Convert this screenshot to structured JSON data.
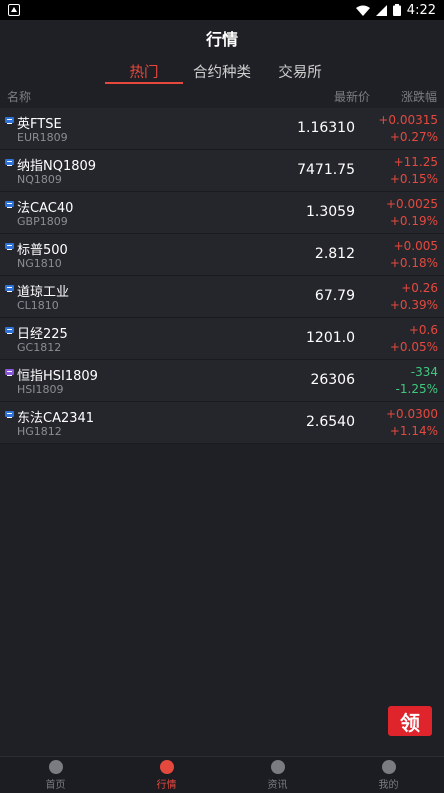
{
  "header": {
    "title": "行情"
  },
  "tabs": [
    {
      "label": "热门",
      "active": true
    },
    {
      "label": "合约种类",
      "active": false
    },
    {
      "label": "交易所",
      "active": false
    }
  ],
  "columns": {
    "name": "名称",
    "price": "最新价",
    "change": "涨跌幅"
  },
  "rows": [
    {
      "name": "英FTSE",
      "code": "EUR1809",
      "price": "1.16310",
      "change": "+0.00315",
      "pct": "+0.27%",
      "dir": "up",
      "badge": "blue"
    },
    {
      "name": "纳指NQ1809",
      "code": "NQ1809",
      "price": "7471.75",
      "change": "+11.25",
      "pct": "+0.15%",
      "dir": "up",
      "badge": "blue"
    },
    {
      "name": "法CAC40",
      "code": "GBP1809",
      "price": "1.3059",
      "change": "+0.0025",
      "pct": "+0.19%",
      "dir": "up",
      "badge": "blue"
    },
    {
      "name": "标普500",
      "code": "NG1810",
      "price": "2.812",
      "change": "+0.005",
      "pct": "+0.18%",
      "dir": "up",
      "badge": "blue"
    },
    {
      "name": "道琼工业",
      "code": "CL1810",
      "price": "67.79",
      "change": "+0.26",
      "pct": "+0.39%",
      "dir": "up",
      "badge": "blue"
    },
    {
      "name": "日经225",
      "code": "GC1812",
      "price": "1201.0",
      "change": "+0.6",
      "pct": "+0.05%",
      "dir": "up",
      "badge": "blue"
    },
    {
      "name": "恒指HSI1809",
      "code": "HSI1809",
      "price": "26306",
      "change": "-334",
      "pct": "-1.25%",
      "dir": "down",
      "badge": "purple"
    },
    {
      "name": "东法CA2341",
      "code": "HG1812",
      "price": "2.6540",
      "change": "+0.0300",
      "pct": "+1.14%",
      "dir": "up",
      "badge": "blue"
    }
  ],
  "float_button": {
    "label": "领"
  },
  "nav": [
    {
      "label": "首页",
      "icon": "home-icon",
      "active": false
    },
    {
      "label": "行情",
      "icon": "chart-icon",
      "active": true
    },
    {
      "label": "资讯",
      "icon": "news-icon",
      "active": false
    },
    {
      "label": "我的",
      "icon": "user-icon",
      "active": false
    }
  ],
  "status_bar": {
    "time": "4:22"
  },
  "colors": {
    "up": "#e5493e",
    "down": "#3fc97d",
    "accent": "#e5493e",
    "background": "#1f2026"
  }
}
